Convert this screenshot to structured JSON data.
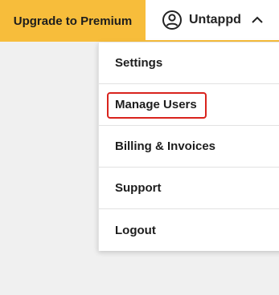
{
  "topbar": {
    "upgrade_label": "Upgrade to Premium",
    "account_label": "Untappd",
    "user_icon": "user-circle-icon",
    "chevron_icon": "chevron-up-icon",
    "accent_color": "#f7bd3b"
  },
  "menu": {
    "items": [
      {
        "label": "Settings"
      },
      {
        "label": "Manage Users",
        "highlighted": true,
        "highlight_color": "#d9231d"
      },
      {
        "label": "Billing & Invoices"
      },
      {
        "label": "Support"
      },
      {
        "label": "Logout"
      }
    ]
  }
}
